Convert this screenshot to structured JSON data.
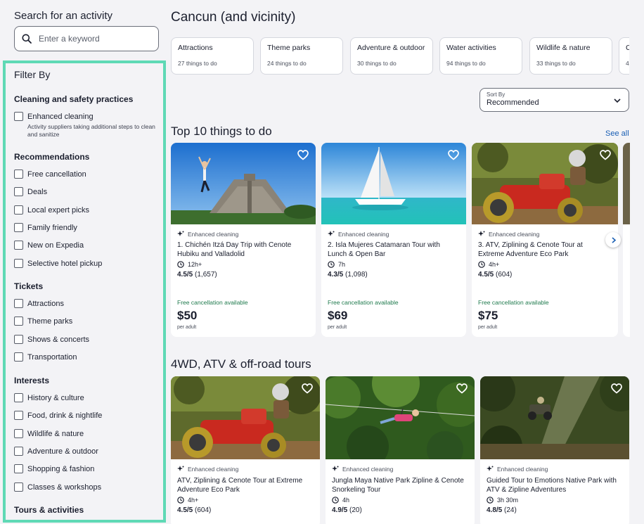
{
  "search": {
    "title": "Search for an activity",
    "placeholder": "Enter a keyword"
  },
  "filters": {
    "title": "Filter By",
    "cleaning": {
      "heading": "Cleaning and safety practices",
      "item": "Enhanced cleaning",
      "desc": "Activity suppliers taking additional steps to clean and sanitize"
    },
    "recommendations": {
      "heading": "Recommendations",
      "items": [
        "Free cancellation",
        "Deals",
        "Local expert picks",
        "Family friendly",
        "New on Expedia",
        "Selective hotel pickup"
      ]
    },
    "tickets": {
      "heading": "Tickets",
      "items": [
        "Attractions",
        "Theme parks",
        "Shows & concerts",
        "Transportation"
      ]
    },
    "interests": {
      "heading": "Interests",
      "items": [
        "History & culture",
        "Food, drink & nightlife",
        "Wildlife & nature",
        "Adventure & outdoor",
        "Shopping & fashion",
        "Classes & workshops"
      ]
    },
    "tours": {
      "heading": "Tours & activities"
    }
  },
  "main": {
    "title": "Cancun (and vicinity)",
    "categories": [
      {
        "name": "Attractions",
        "count": "27 things to do"
      },
      {
        "name": "Theme parks",
        "count": "24 things to do"
      },
      {
        "name": "Adventure & outdoor",
        "count": "30 things to do"
      },
      {
        "name": "Water activities",
        "count": "94 things to do"
      },
      {
        "name": "Wildlife & nature",
        "count": "33 things to do"
      },
      {
        "name": "C",
        "count": "4"
      }
    ],
    "sort": {
      "label": "Sort By",
      "value": "Recommended"
    },
    "top10": {
      "title": "Top 10 things to do",
      "see_all": "See all",
      "cards": [
        {
          "badge": "Enhanced cleaning",
          "title": "1. Chichén Itzá Day Trip with Cenote Hubiku and Valladolid",
          "duration": "12h+",
          "rating": "4.5/5",
          "reviews": "(1,657)",
          "free_cancel": "Free cancellation available",
          "price": "$50",
          "per": "per adult"
        },
        {
          "badge": "Enhanced cleaning",
          "title": "2. Isla Mujeres Catamaran Tour with Lunch & Open Bar",
          "duration": "7h",
          "rating": "4.3/5",
          "reviews": "(1,098)",
          "free_cancel": "Free cancellation available",
          "price": "$69",
          "per": "per adult"
        },
        {
          "badge": "Enhanced cleaning",
          "title": "3. ATV, Ziplining & Cenote Tour at Extreme Adventure Eco Park",
          "duration": "4h+",
          "rating": "4.5/5",
          "reviews": "(604)",
          "free_cancel": "Free cancellation available",
          "price": "$75",
          "per": "per adult"
        }
      ]
    },
    "atv": {
      "title": "4WD, ATV & off-road tours",
      "cards": [
        {
          "badge": "Enhanced cleaning",
          "title": "ATV, Ziplining & Cenote Tour at Extreme Adventure Eco Park",
          "duration": "4h+",
          "rating": "4.5/5",
          "reviews": "(604)"
        },
        {
          "badge": "Enhanced cleaning",
          "title": "Jungla Maya Native Park Zipline & Cenote Snorkeling Tour",
          "duration": "4h",
          "rating": "4.9/5",
          "reviews": "(20)"
        },
        {
          "badge": "Enhanced cleaning",
          "title": "Guided Tour to Emotions Native Park with ATV & Zipline Adventures",
          "duration": "3h 30m",
          "rating": "4.8/5",
          "reviews": "(24)"
        }
      ]
    }
  }
}
